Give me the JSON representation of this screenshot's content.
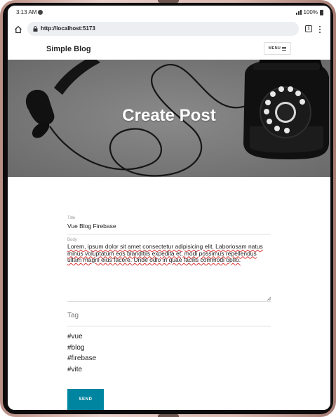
{
  "status": {
    "time": "3:13 AM",
    "battery": "100%"
  },
  "browser": {
    "url": "http://localhost:5173",
    "tab_count": "1"
  },
  "nav": {
    "brand": "Simple Blog",
    "menu_label": "MENU"
  },
  "hero": {
    "title": "Create Post"
  },
  "form": {
    "title_label": "Title",
    "title_value": "Vue Blog Firebase",
    "body_label": "Body",
    "body_value": "Lorem, ipsum dolor sit amet consectetur adipisicing elit. Laboriosam natus minus voluptatum eos blanditiis expedita et, modi possimus repellendus ullam magni eius facere. Unde odio in quae facilis commodi optio.",
    "tag_placeholder": "Tag",
    "tags": [
      "#vue",
      "#blog",
      "#firebase",
      "#vite"
    ],
    "send_label": "SEND"
  },
  "colors": {
    "accent": "#0085a1",
    "hero_bg": "#7a7a7a"
  }
}
